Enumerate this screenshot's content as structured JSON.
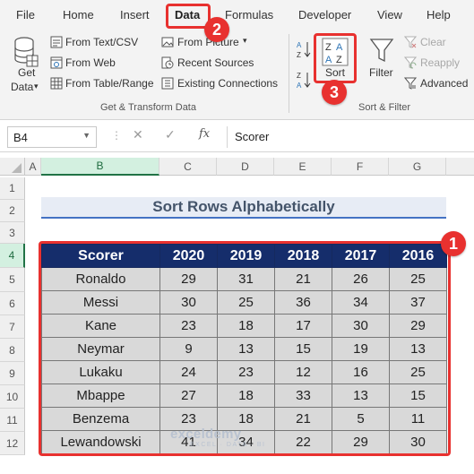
{
  "ribbon_tabs": [
    {
      "label": "File"
    },
    {
      "label": "Home"
    },
    {
      "label": "Insert"
    },
    {
      "label": "Data"
    },
    {
      "label": "Formulas"
    },
    {
      "label": "Developer"
    },
    {
      "label": "View"
    },
    {
      "label": "Help"
    }
  ],
  "get_transform": {
    "get_data_line1": "Get",
    "get_data_line2": "Data",
    "from_text_csv": "From Text/CSV",
    "from_web": "From Web",
    "from_table_range": "From Table/Range",
    "from_picture": "From Picture",
    "recent_sources": "Recent Sources",
    "existing_connections": "Existing Connections",
    "group_label": "Get & Transform Data"
  },
  "sort_filter": {
    "sort": "Sort",
    "filter": "Filter",
    "clear": "Clear",
    "reapply": "Reapply",
    "advanced": "Advanced",
    "group_label": "Sort & Filter"
  },
  "badges": [
    "1",
    "2",
    "3"
  ],
  "formula_bar": {
    "name_box": "B4",
    "fx": "fx",
    "formula": "Scorer"
  },
  "grid": {
    "columns": [
      "A",
      "B",
      "C",
      "D",
      "E",
      "F",
      "G"
    ],
    "rows": [
      "1",
      "2",
      "3",
      "4",
      "5",
      "6",
      "7",
      "8",
      "9",
      "10",
      "11",
      "12"
    ]
  },
  "sheet": {
    "title": "Sort Rows Alphabetically",
    "headers": [
      "Scorer",
      "2020",
      "2019",
      "2018",
      "2017",
      "2016"
    ],
    "rows": [
      [
        "Ronaldo",
        "29",
        "31",
        "21",
        "26",
        "25"
      ],
      [
        "Messi",
        "30",
        "25",
        "36",
        "34",
        "37"
      ],
      [
        "Kane",
        "23",
        "18",
        "17",
        "30",
        "29"
      ],
      [
        "Neymar",
        "9",
        "13",
        "15",
        "19",
        "13"
      ],
      [
        "Lukaku",
        "24",
        "23",
        "12",
        "16",
        "25"
      ],
      [
        "Mbappe",
        "27",
        "18",
        "33",
        "13",
        "15"
      ],
      [
        "Benzema",
        "23",
        "18",
        "21",
        "5",
        "11"
      ],
      [
        "Lewandowski",
        "41",
        "34",
        "22",
        "29",
        "30"
      ]
    ]
  },
  "watermark": {
    "title": "exceldemy",
    "subtitle": "EXCEL · DATA · BI"
  },
  "colors": {
    "accent_green": "#217346",
    "header_navy": "#152d6b",
    "callout_red": "#e8312f",
    "cell_gray": "#d9d9d9"
  }
}
